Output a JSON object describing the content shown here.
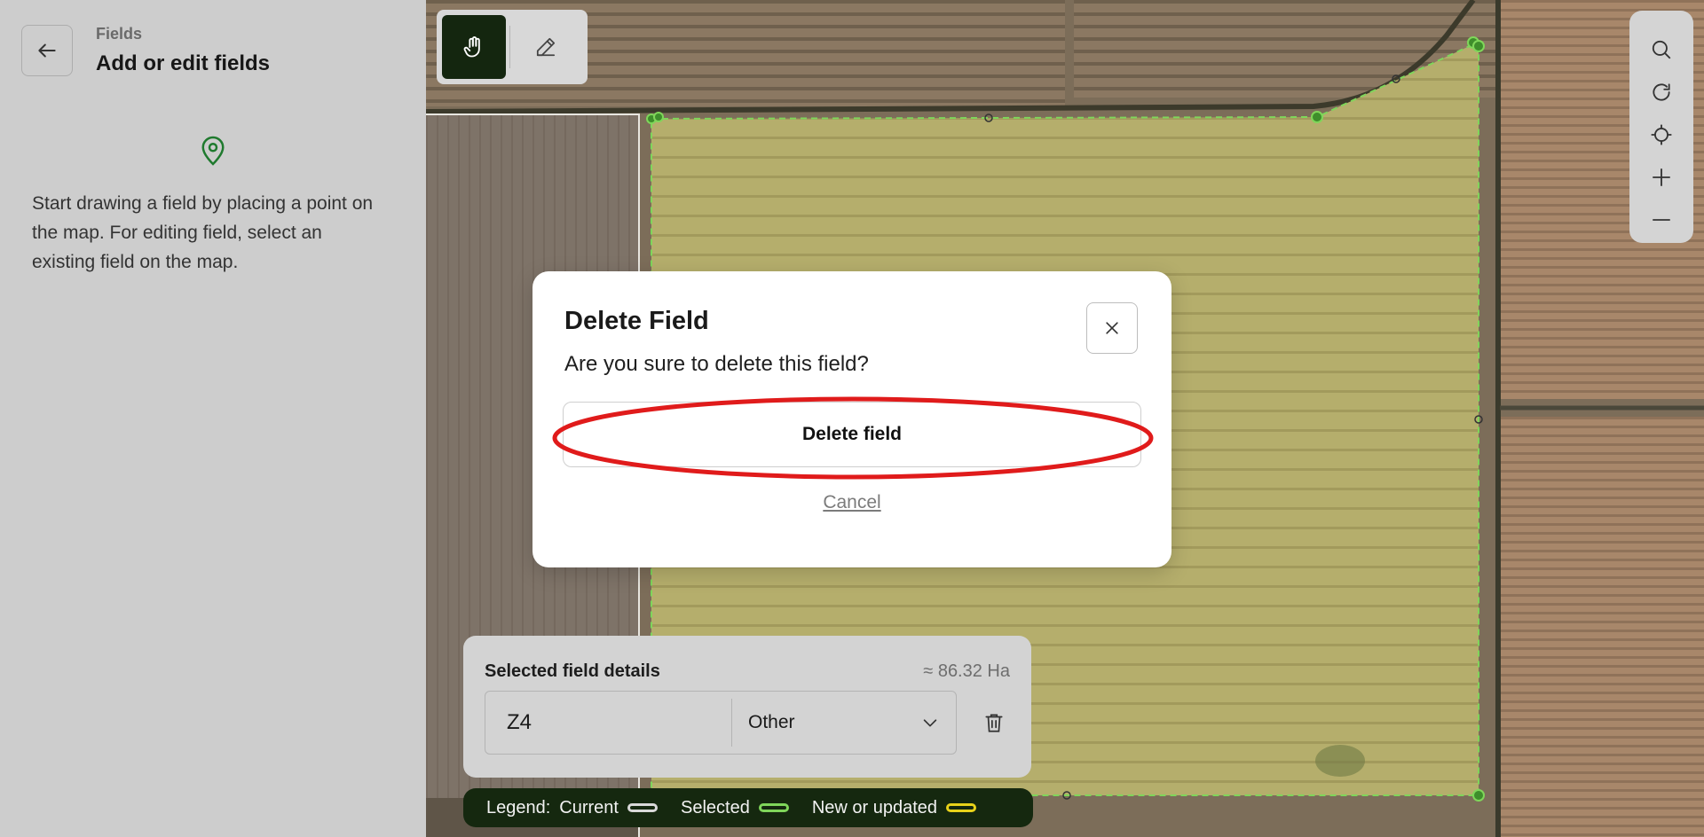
{
  "sidebar": {
    "breadcrumb": "Fields",
    "title": "Add or edit fields",
    "help_text": "Start drawing a field by placing a point on the map. For editing field, select an existing field on the map."
  },
  "details": {
    "title": "Selected field details",
    "area": "≈ 86.32 Ha",
    "field_name": "Z4",
    "field_type": "Other"
  },
  "legend": {
    "label": "Legend:",
    "items": [
      {
        "label": "Current",
        "color": "#d9d9d9"
      },
      {
        "label": "Selected",
        "color": "#7fd65a"
      },
      {
        "label": "New or updated",
        "color": "#e8d21a"
      }
    ]
  },
  "modal": {
    "title": "Delete Field",
    "message": "Are you sure to delete this field?",
    "delete_label": "Delete field",
    "cancel_label": "Cancel"
  },
  "colors": {
    "accent_dark": "#14260f",
    "pin_green": "#1f7a2e",
    "highlight_red": "#e01b1b"
  },
  "icons": [
    "back-arrow-icon",
    "location-pin-icon",
    "hand-icon",
    "pencil-icon",
    "search-icon",
    "refresh-icon",
    "crosshair-icon",
    "plus-icon",
    "minus-icon",
    "chevron-down-icon",
    "trash-icon",
    "close-icon"
  ]
}
